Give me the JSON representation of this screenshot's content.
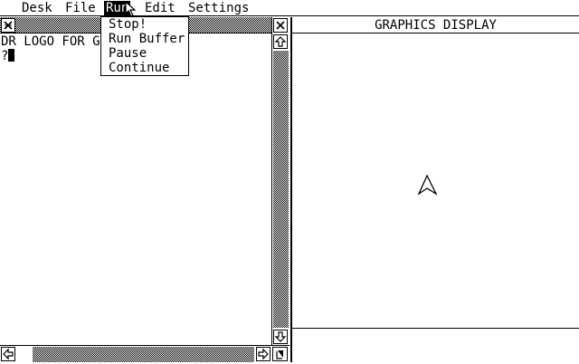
{
  "menubar": {
    "items": [
      "Desk",
      "File",
      "Run",
      "Edit",
      "Settings"
    ],
    "active": "Run"
  },
  "run_menu": {
    "items": [
      "Stop!",
      "Run Buffer",
      "Pause",
      "Continue"
    ]
  },
  "listener": {
    "banner": "DR LOGO FOR GE",
    "prompt": "?"
  },
  "graphics": {
    "title": "GRAPHICS DISPLAY"
  },
  "icons": {
    "close": "close-icon",
    "scroll_up": "arrow-up-icon",
    "scroll_down": "arrow-down-icon",
    "scroll_left": "arrow-left-icon",
    "scroll_right": "arrow-right-icon",
    "resize": "resize-icon",
    "turtle": "turtle-icon",
    "pointer": "mouse-pointer-icon"
  }
}
